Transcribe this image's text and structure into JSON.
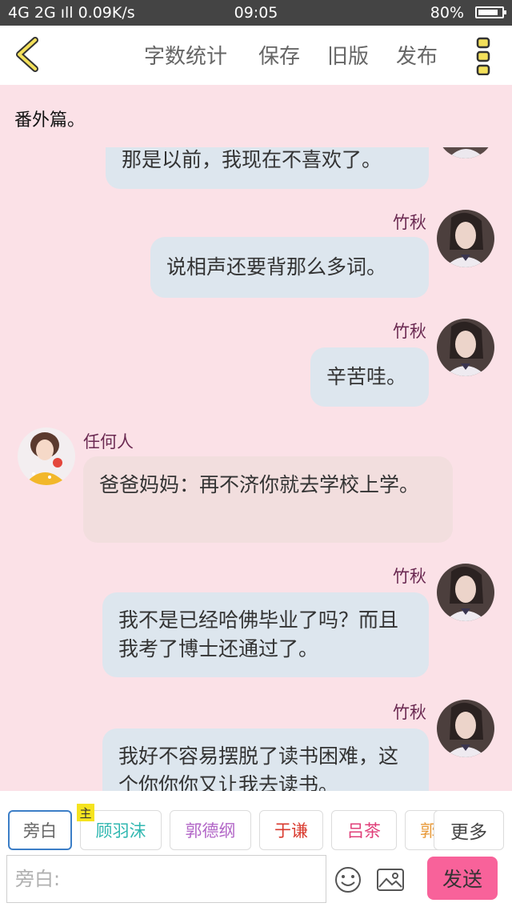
{
  "status_bar": {
    "network": "4G 2G ıll 0.09K/s",
    "time": "09:05",
    "battery": "80%"
  },
  "toolbar": {
    "word_count": "字数统计",
    "save": "保存",
    "old_version": "旧版",
    "publish": "发布"
  },
  "subtitle": "番外篇。",
  "messages": [
    {
      "side": "right",
      "text": "那是以前，我现在不喜欢了。"
    },
    {
      "side": "right",
      "name": "竹秋",
      "text": "说相声还要背那么多词。"
    },
    {
      "side": "right",
      "name": "竹秋",
      "text": "辛苦哇。"
    },
    {
      "side": "left",
      "name": "任何人",
      "text": "爸爸妈妈：再不济你就去学校上学。"
    },
    {
      "side": "right",
      "name": "竹秋",
      "text": "我不是已经哈佛毕业了吗？而且我考了博士还通过了。"
    },
    {
      "side": "right",
      "name": "竹秋",
      "text": "我好不容易摆脱了读书困难，这个你你你又让我去读书。"
    }
  ],
  "characters": [
    {
      "label": "旁白",
      "color": "#666666"
    },
    {
      "label": "顾羽沫",
      "color": "#2fb7b0",
      "badge": "主"
    },
    {
      "label": "郭德纲",
      "color": "#b266c7"
    },
    {
      "label": "于谦",
      "color": "#d93a2e"
    },
    {
      "label": "吕茶",
      "color": "#e0407a"
    },
    {
      "label": "郭",
      "color": "#e89a3a"
    }
  ],
  "more": "更多",
  "input": {
    "placeholder": "旁白:"
  },
  "send": "发送",
  "colors": {
    "accent": "#f8629a",
    "background": "#fbe1e7",
    "name": "#6b2a52"
  },
  "icons": [
    "back-chevron-icon",
    "more-dots-icon",
    "emoji-icon",
    "image-icon"
  ]
}
